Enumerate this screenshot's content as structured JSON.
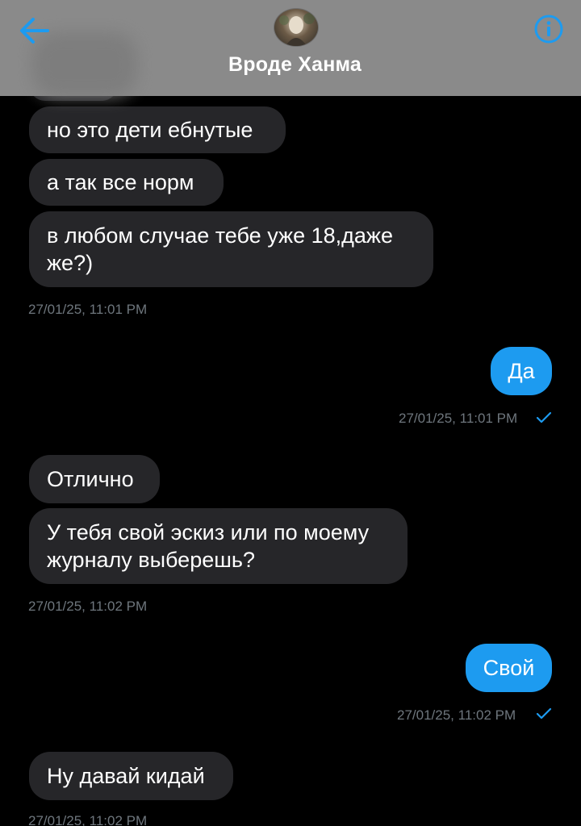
{
  "header": {
    "title": "Вроде Ханма",
    "back_icon": "arrow-left-icon",
    "info_icon": "info-circle-icon",
    "accent": "#1d9bf0",
    "background": "#8a8a8a"
  },
  "messages": [
    {
      "direction": "in",
      "text": "но это дети ебнутые"
    },
    {
      "direction": "in",
      "text": "а так все норм"
    },
    {
      "direction": "in",
      "text": "в любом случае тебе уже 18,даже же?)"
    },
    {
      "direction": "in",
      "timestamp": "27/01/25, 11:01 PM"
    },
    {
      "direction": "out",
      "text": "Да",
      "timestamp": "27/01/25, 11:01 PM"
    },
    {
      "direction": "in",
      "text": "Отлично"
    },
    {
      "direction": "in",
      "text": "У тебя свой эскиз или по моему журналу выберешь?",
      "timestamp": "27/01/25, 11:02 PM"
    },
    {
      "direction": "out",
      "text": "Свой",
      "timestamp": "27/01/25, 11:02 PM"
    },
    {
      "direction": "in",
      "text": "Ну давай кидай",
      "timestamp": "27/01/25, 11:02 PM"
    }
  ],
  "colors": {
    "incoming_bubble": "#262629",
    "outgoing_bubble": "#1d9bf0",
    "timestamp": "#6e767d",
    "background": "#000000"
  }
}
